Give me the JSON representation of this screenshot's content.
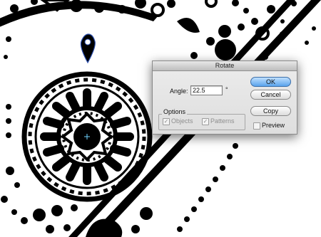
{
  "dialog": {
    "title": "Rotate",
    "angle_label": "Angle:",
    "angle_value": "22.5",
    "angle_unit": "°",
    "options_title": "Options",
    "objects_label": "Objects",
    "objects_checked": true,
    "patterns_label": "Patterns",
    "patterns_checked": true,
    "ok_label": "OK",
    "cancel_label": "Cancel",
    "copy_label": "Copy",
    "preview_label": "Preview",
    "preview_checked": false
  },
  "canvas": {
    "artwork": "black-and-white folk mandala pattern",
    "accent_color": "#2b4fb0",
    "selection_marker_icon": "teardrop-anchor-icon",
    "center_point_icon": "rotation-center-icon"
  }
}
